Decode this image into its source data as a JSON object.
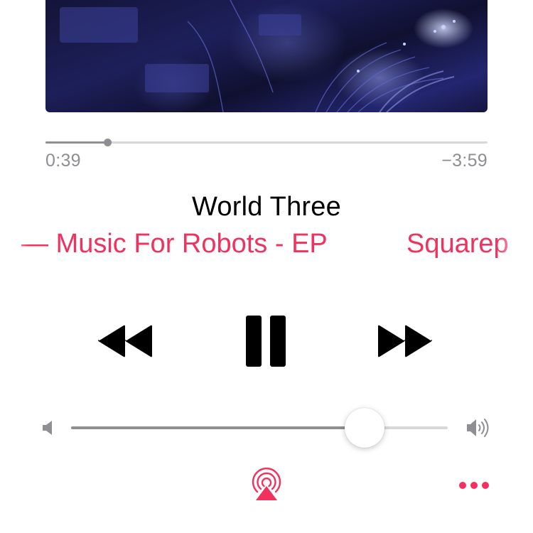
{
  "artwork": {
    "icon": "album-artwork-image"
  },
  "playback": {
    "elapsed": "0:39",
    "remaining": "−3:59",
    "progress_fraction": 0.14
  },
  "track": {
    "title": "World Three",
    "subtitle_marquee": "— Music For Robots - EP",
    "subtitle_marquee_next": "Squarep"
  },
  "controls": {
    "rewind_icon": "rewind-icon",
    "pause_icon": "pause-icon",
    "forward_icon": "fast-forward-icon"
  },
  "volume": {
    "level_fraction": 0.78,
    "low_icon": "speaker-low-icon",
    "high_icon": "speaker-high-icon"
  },
  "footer": {
    "airplay_icon": "airplay-icon",
    "more_icon": "more-icon"
  },
  "colors": {
    "accent": "#f2315e",
    "track_fill": "#8e8e93",
    "track_bg": "#d8d8dc"
  }
}
